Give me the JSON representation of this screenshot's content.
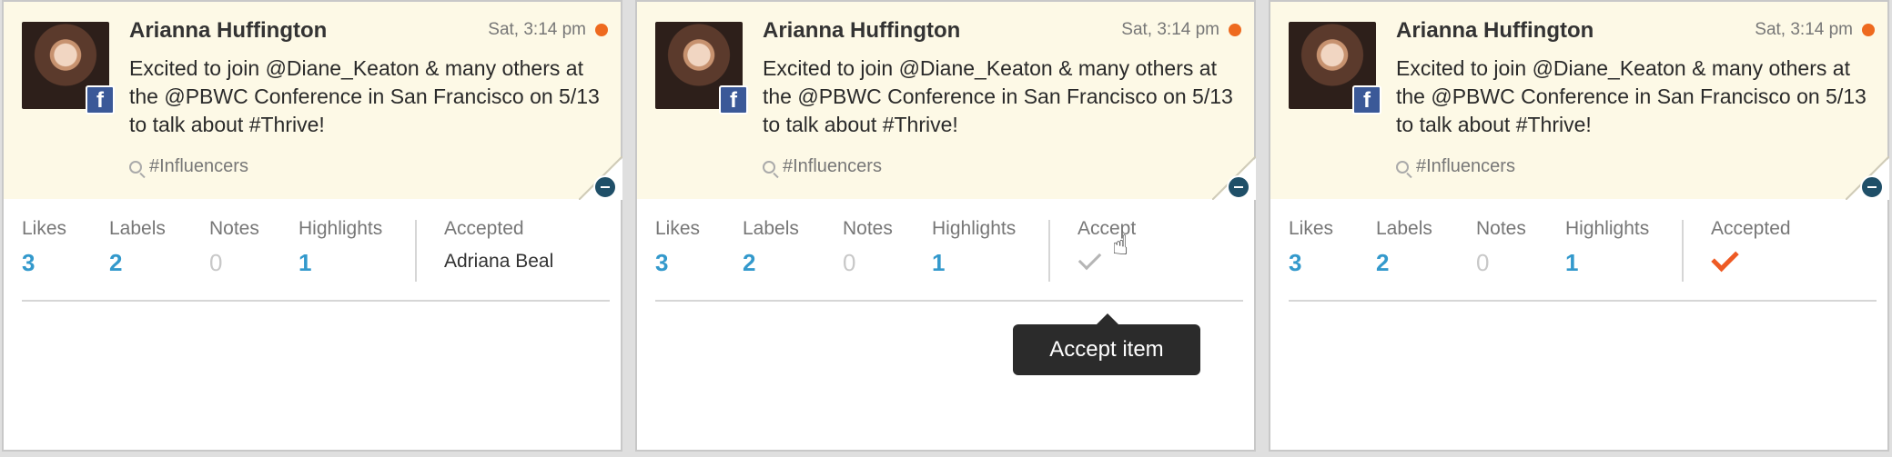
{
  "cards": [
    {
      "author": "Arianna Huffington",
      "time": "Sat, 3:14 pm",
      "post": "Excited to join @Diane_Keaton & many others at the @PBWC Conference in San Francisco on 5/13 to talk about #Thrive!",
      "tag": "#Influencers",
      "stats": [
        {
          "label": "Likes",
          "value": "3"
        },
        {
          "label": "Labels",
          "value": "2"
        },
        {
          "label": "Notes",
          "value": "0"
        },
        {
          "label": "Highlights",
          "value": "1"
        }
      ],
      "accepted_label": "Accepted",
      "accepted_value": "Adriana Beal"
    },
    {
      "author": "Arianna Huffington",
      "time": "Sat, 3:14 pm",
      "post": "Excited to join @Diane_Keaton & many others at the @PBWC Conference in San Francisco on 5/13 to talk about #Thrive!",
      "tag": "#Influencers",
      "stats": [
        {
          "label": "Likes",
          "value": "3"
        },
        {
          "label": "Labels",
          "value": "2"
        },
        {
          "label": "Notes",
          "value": "0"
        },
        {
          "label": "Highlights",
          "value": "1"
        }
      ],
      "accepted_label": "Accept",
      "tooltip": "Accept item"
    },
    {
      "author": "Arianna Huffington",
      "time": "Sat, 3:14 pm",
      "post": "Excited to join @Diane_Keaton & many others at the @PBWC Conference in San Francisco on 5/13 to talk about #Thrive!",
      "tag": "#Influencers",
      "stats": [
        {
          "label": "Likes",
          "value": "3"
        },
        {
          "label": "Labels",
          "value": "2"
        },
        {
          "label": "Notes",
          "value": "0"
        },
        {
          "label": "Highlights",
          "value": "1"
        }
      ],
      "accepted_label": "Accepted"
    }
  ],
  "colors": {
    "card_top_bg": "#fdf9e6",
    "stat_value": "#3399cc",
    "status_dot": "#ee6a1f",
    "accepted_check": "#ee5a24",
    "facebook": "#3b5998"
  },
  "icons": {
    "network": "facebook-icon",
    "tag": "search-icon",
    "collapse": "minus-icon",
    "accept_gray": "check-icon",
    "accept_done": "check-icon",
    "cursor": "hand-cursor-icon"
  }
}
